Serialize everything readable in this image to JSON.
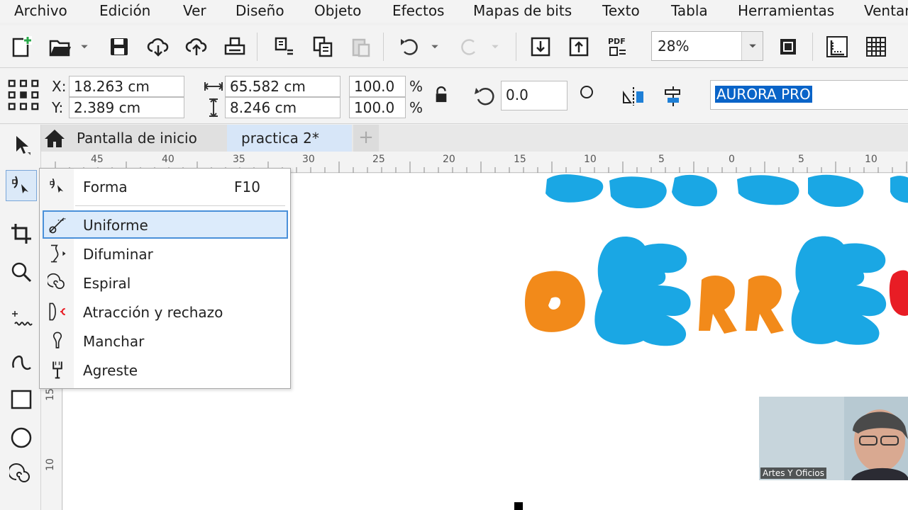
{
  "menu": [
    "Archivo",
    "Edición",
    "Ver",
    "Diseño",
    "Objeto",
    "Efectos",
    "Mapas de bits",
    "Texto",
    "Tabla",
    "Herramientas",
    "Ventana"
  ],
  "toolbar": {
    "icons": [
      "new-document-icon",
      "open-icon",
      "dropdown-arrow-icon",
      "save-icon",
      "cloud-download-icon",
      "cloud-upload-icon",
      "print-icon",
      "cut-icon",
      "copy-icon",
      "paste-icon",
      "undo-icon",
      "redo-icon",
      "import-icon",
      "export-icon",
      "pdf-icon",
      "full-screen-icon",
      "rulers-icon",
      "grid-icon"
    ],
    "pdf_label": "PDF",
    "zoom": "28%"
  },
  "properties": {
    "x_label": "X:",
    "x_value": "18.263 cm",
    "y_label": "Y:",
    "y_value": "2.389 cm",
    "width_value": "65.582 cm",
    "height_value": "8.246 cm",
    "scale_x": "100.0",
    "scale_y": "100.0",
    "percent": "%",
    "rotation": "0.0",
    "font_name": "AURORA PRO"
  },
  "tabs": [
    {
      "label": "Pantalla de inicio"
    },
    {
      "label": "practica 2*"
    }
  ],
  "rulers": {
    "h": [
      "45",
      "40",
      "35",
      "30",
      "25",
      "20",
      "15",
      "10",
      "5",
      "0",
      "5",
      "10"
    ],
    "v": [
      "15",
      "10"
    ]
  },
  "flyout": {
    "items": [
      {
        "label": "Forma",
        "shortcut": "F10",
        "icon": "shape-tool-icon"
      },
      {
        "label": "Uniforme",
        "icon": "smooth-tool-icon",
        "selected": true
      },
      {
        "label": "Difuminar",
        "icon": "smear-tool-icon"
      },
      {
        "label": "Espiral",
        "icon": "twirl-tool-icon"
      },
      {
        "label": "Atracción y rechazo",
        "icon": "attract-repel-tool-icon"
      },
      {
        "label": "Manchar",
        "icon": "smudge-tool-icon"
      },
      {
        "label": "Agreste",
        "icon": "roughen-tool-icon"
      }
    ]
  },
  "colors": {
    "accent": "#0a64c8",
    "blob_blue": "#1aa7e4",
    "blob_orange": "#f28a1a",
    "blob_red": "#e81d25"
  },
  "webcam": {
    "label": "Artes Y Oficios"
  }
}
